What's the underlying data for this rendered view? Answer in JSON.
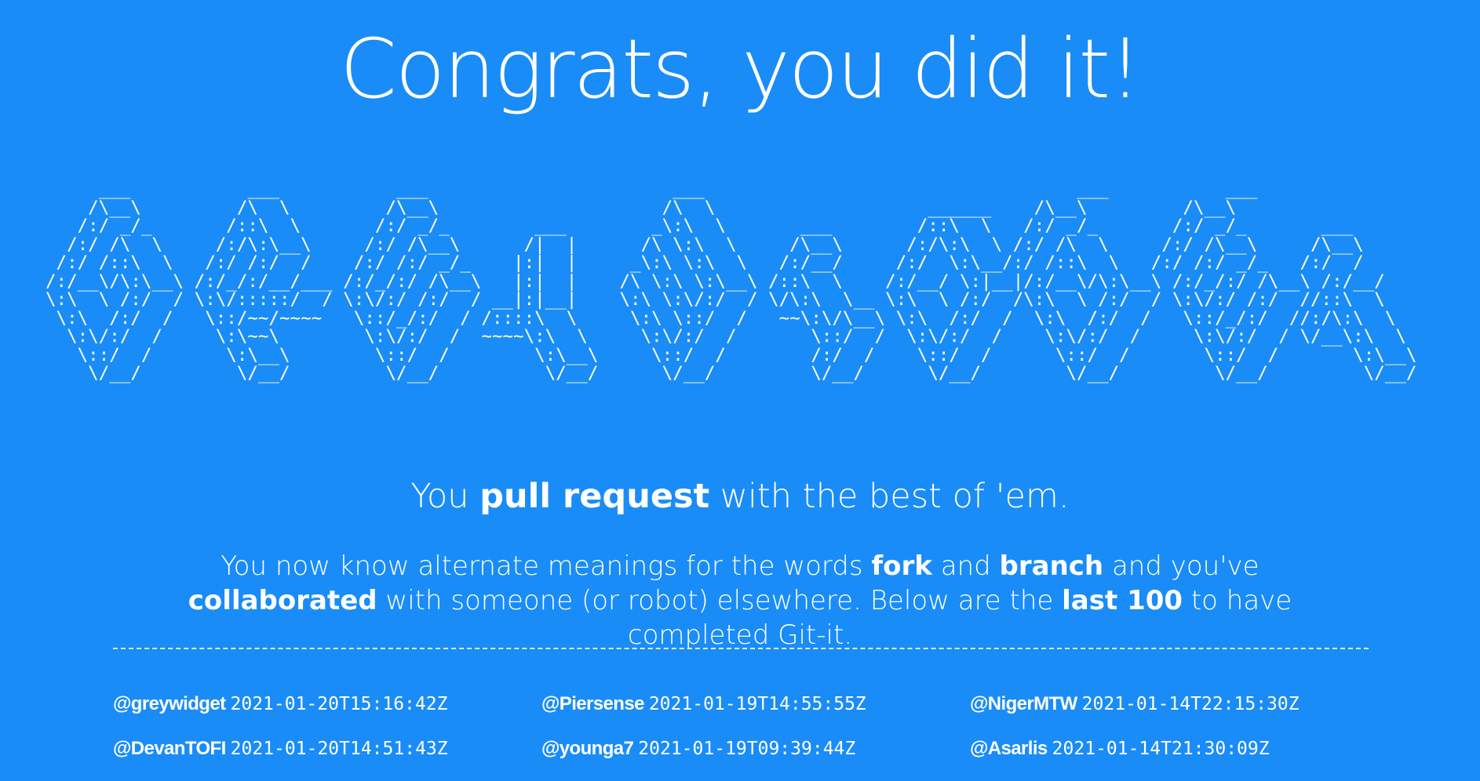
{
  "page": {
    "title": "Congrats, you did it!",
    "ascii_art": "     ___           ___           ___                       ___                                   ___           ___    \n    /\\__\\         /\\  \\         /\\__\\                     /\\  \\                    ______    /\\__\\         /\\__\\   \n   /:/ _/_       /::\\  \\       /:/ _/_        ___        _\\:\\  \\       ___        /::\\  \\   /:/ _/_       /:/ _/_       ___   \n  /:/ /\\  \\     /:/\\:\\__\\     /:/ /\\__\\      /|  |      /\\ \\:\\  \\     /\\__\\      /:/\\:\\  \\ /:/ /\\  \\     /:/ /\\__\\     /\\__\\  \n /:/ /::\\  \\   /:/ /:/  /    /:/ /:/ _/_    |:|  |     _\\:\\ \\:\\  \\   /:/__/     /:/  \\:\\__/:/ /::\\  \\   /:/ /:/ _/_   /:/  /  \n/:/__\\/\\:\\__\\ /:/_/:/__/___ /:/_/:/ /\\__\\   |:|  |    /\\ \\:\\ \\:\\__\\ /::\\  \\    /:/__/ \\:|__|/:/__\\/\\:\\__\\ /:/_/:/ /\\__\\ /:/__/   \n\\:\\  \\ /:/  / \\:\\/:::::/  / \\:\\/:/ /:/  / __|:|__|    \\:\\ \\:\\/:/  / \\/\\:\\  \\__ \\:\\  \\ /:/  /\\:\\  \\ /:/  / \\:\\/:/ /:/  //::\\  \\   \n \\:\\  /:/  /   \\::/~~/~~~~   \\::/_/:/  / /::::\\  \\     \\:\\ \\::/  /   ~~\\:\\/\\__\\ \\:\\  /:/  /  \\:\\  /:/  /   \\::/_/:/  //:/\\:\\  \\  \n  \\:\\/:/  /     \\:\\~~\\        \\:\\/:/  /  ~~~~\\:\\  \\     \\:\\/:/  /       \\::/  /  \\:\\/:/  /    \\:\\/:/  /     \\:\\/:/  / \\/__\\:\\  \\ \n   \\::/  /       \\:\\__\\        \\::/  /        \\:\\__\\     \\::/  /        /:/  /    \\::/  /      \\::/  /       \\::/  /       \\:\\__\\\n    \\/__/         \\/__/         \\/__/          \\/__/      \\/__/         \\/__/      \\/__/        \\/__/         \\/__/         \\/__/",
    "tagline": {
      "prefix": "You ",
      "bold": "pull request",
      "suffix": " with the best of 'em."
    },
    "description": {
      "part1": "You now know alternate meanings for the words ",
      "fork": "fork",
      "part2": " and ",
      "branch": "branch",
      "part3": " and you've ",
      "collaborated": "collaborated",
      "part4": " with someone (or robot) elsewhere. Below are the ",
      "last100": "last 100",
      "part5": " to have completed Git-it."
    }
  },
  "completers": [
    {
      "user": "@greywidget",
      "time": "2021-01-20T15:16:42Z"
    },
    {
      "user": "@Piersense",
      "time": "2021-01-19T14:55:55Z"
    },
    {
      "user": "@NigerMTW",
      "time": "2021-01-14T22:15:30Z"
    },
    {
      "user": "@DevanTOFI",
      "time": "2021-01-20T14:51:43Z"
    },
    {
      "user": "@younga7",
      "time": "2021-01-19T09:39:44Z"
    },
    {
      "user": "@Asarlis",
      "time": "2021-01-14T21:30:09Z"
    }
  ]
}
